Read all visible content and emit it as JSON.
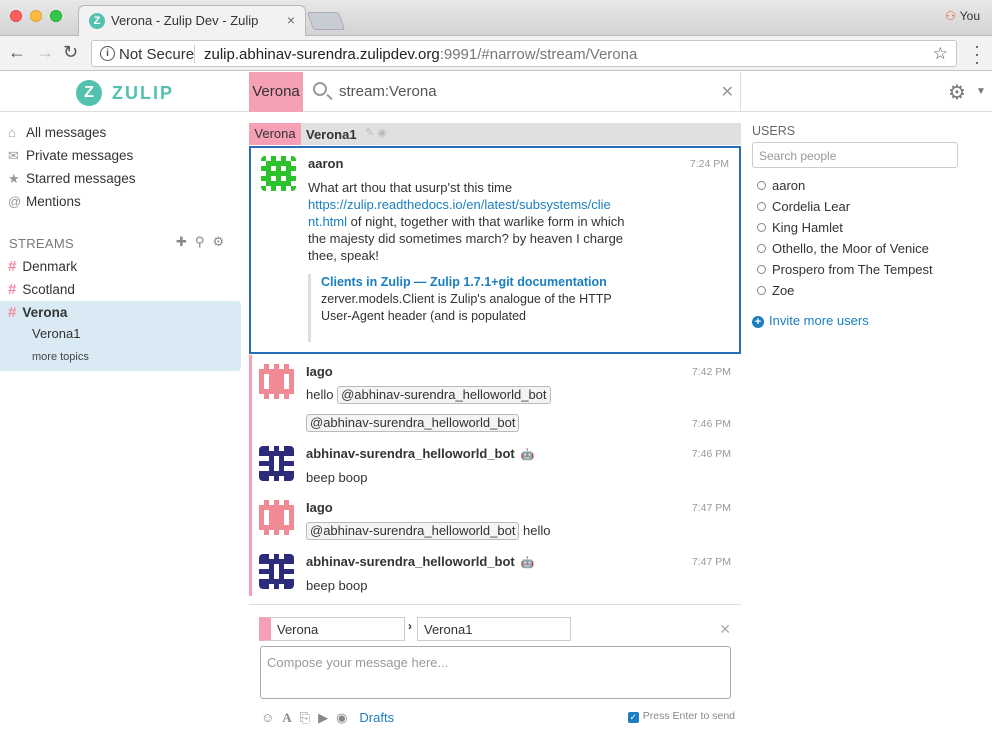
{
  "browser": {
    "tab_title": "Verona - Zulip Dev - Zulip",
    "tab_favicon": "Z",
    "tab_close": "×",
    "profile": "You",
    "security": "Not Secure",
    "url_host": "zulip.abhinav-surendra.zulipdev.org",
    "url_rest": ":9991/#narrow/stream/Verona"
  },
  "header": {
    "logo_letter": "Z",
    "logo_text": "ZULIP",
    "narrow_stream": "Verona",
    "search_query": "stream:Verona"
  },
  "left_sidebar": {
    "nav": [
      {
        "label": "All messages",
        "icon": "home-icon"
      },
      {
        "label": "Private messages",
        "icon": "envelope-icon"
      },
      {
        "label": "Starred messages",
        "icon": "star-icon"
      },
      {
        "label": "Mentions",
        "icon": "at-icon"
      }
    ],
    "streams_heading": "STREAMS",
    "streams": [
      "Denmark",
      "Scotland",
      "Verona"
    ],
    "active_topic": "Verona1",
    "more_topics": "more topics"
  },
  "recipient": {
    "stream": "Verona",
    "topic": "Verona1"
  },
  "messages": [
    {
      "sender": "aaron",
      "time": "7:24 PM",
      "text_1": "What art thou that usurp'st this time",
      "link_1": "https://zulip.readthedocs.io/en/latest/subsystems/clie",
      "link_2": "nt.html",
      "text_2": " of night, together with that warlike form in which the majesty did sometimes march? by heaven I charge thee, speak!",
      "preview_title": "Clients in Zulip — Zulip 1.7.1+git documentation",
      "preview_desc": "zerver.models.Client is Zulip's analogue of the HTTP User-Agent header (and is populated"
    },
    {
      "sender": "Iago",
      "time": "7:42 PM",
      "pre": "hello ",
      "mention": "@abhinav-surendra_helloworld_bot"
    },
    {
      "time": "7:46 PM",
      "mention": "@abhinav-surendra_helloworld_bot"
    },
    {
      "sender": "abhinav-surendra_helloworld_bot",
      "time": "7:46 PM",
      "text": "beep boop"
    },
    {
      "sender": "Iago",
      "time": "7:47 PM",
      "mention": "@abhinav-surendra_helloworld_bot",
      "post": " hello"
    },
    {
      "sender": "abhinav-surendra_helloworld_bot",
      "time": "7:47 PM",
      "text": "beep boop"
    }
  ],
  "right_sidebar": {
    "users_heading": "USERS",
    "search_placeholder": "Search people",
    "users": [
      "aaron",
      "Cordelia Lear",
      "King Hamlet",
      "Othello, the Moor of Venice",
      "Prospero from The Tempest",
      "Zoe"
    ],
    "invite": "Invite more users"
  },
  "compose": {
    "stream": "Verona",
    "topic": "Verona1",
    "placeholder": "Compose your message here...",
    "drafts": "Drafts",
    "enter_to_send": "Press Enter to send"
  },
  "colors": {
    "stream_verona": "#f5a0b5",
    "brand": "#52c2af",
    "link": "#1a7ec0",
    "selected_border": "#2a6bb5"
  }
}
